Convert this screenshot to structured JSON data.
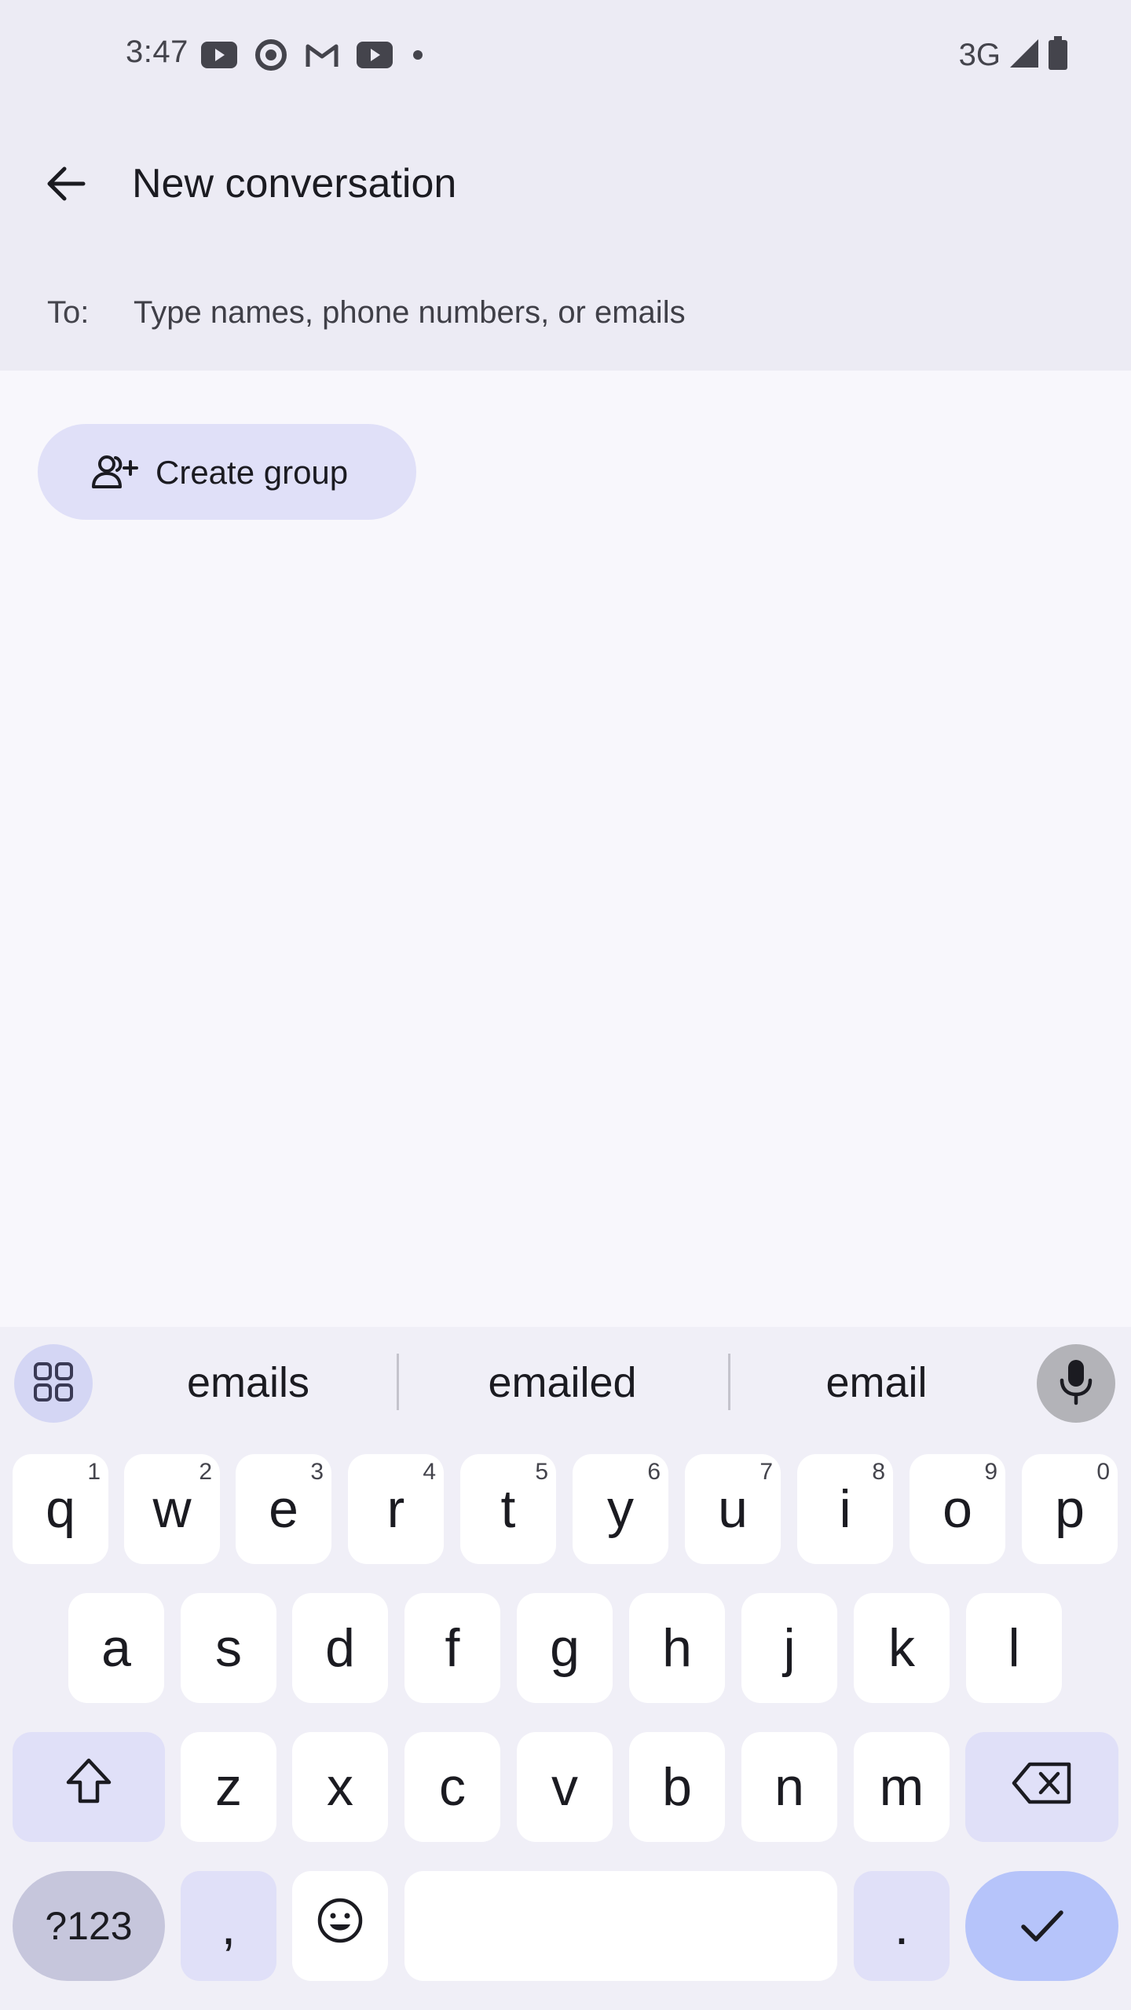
{
  "status_bar": {
    "time": "3:47",
    "notification_icons": [
      "youtube-icon",
      "target-icon",
      "gmail-icon",
      "youtube-icon",
      "dot-icon"
    ],
    "network": "3G",
    "signal_icon": "signal-icon",
    "battery_icon": "battery-icon"
  },
  "app_bar": {
    "back_icon": "arrow-back-icon",
    "title": "New conversation"
  },
  "recipient": {
    "label": "To:",
    "placeholder": "Type names, phone numbers, or emails",
    "value": ""
  },
  "create_group": {
    "icon": "add-people-icon",
    "label": "Create group"
  },
  "keyboard": {
    "suggestions": [
      "emails",
      "emailed",
      "email"
    ],
    "row1": [
      {
        "char": "q",
        "num": "1"
      },
      {
        "char": "w",
        "num": "2"
      },
      {
        "char": "e",
        "num": "3"
      },
      {
        "char": "r",
        "num": "4"
      },
      {
        "char": "t",
        "num": "5"
      },
      {
        "char": "y",
        "num": "6"
      },
      {
        "char": "u",
        "num": "7"
      },
      {
        "char": "i",
        "num": "8"
      },
      {
        "char": "o",
        "num": "9"
      },
      {
        "char": "p",
        "num": "0"
      }
    ],
    "row2": [
      "a",
      "s",
      "d",
      "f",
      "g",
      "h",
      "j",
      "k",
      "l"
    ],
    "row3": [
      "z",
      "x",
      "c",
      "v",
      "b",
      "n",
      "m"
    ],
    "symbols_label": "?123",
    "comma": ",",
    "period": ".",
    "colors": {
      "key": "#ffffff",
      "function_key": "#e0e0f8",
      "enter_key": "#b6c4fa",
      "background": "#f0eff7"
    }
  }
}
